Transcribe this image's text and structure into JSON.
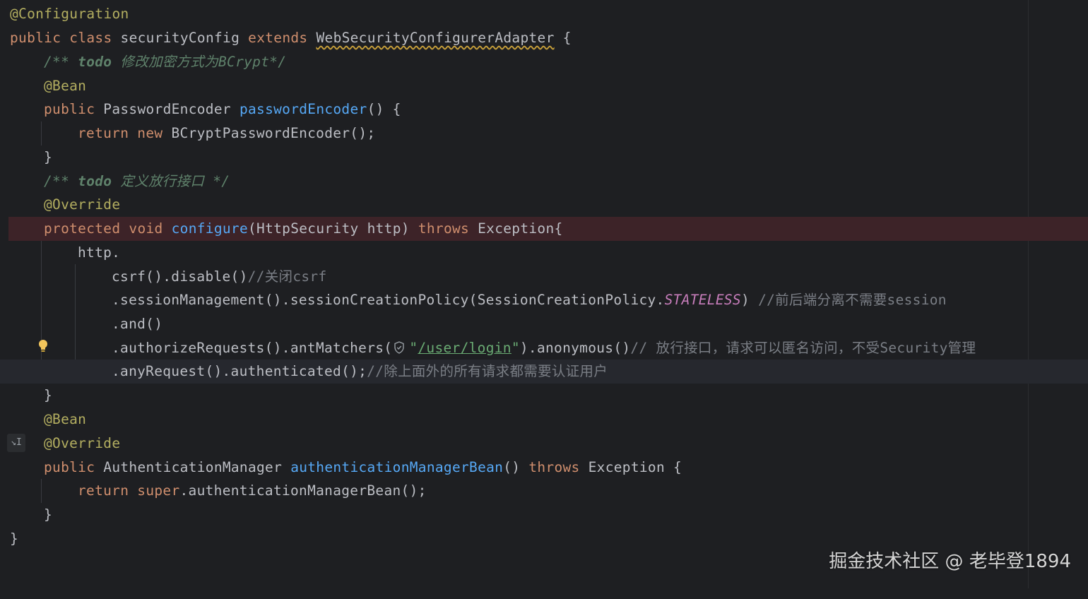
{
  "code": {
    "l1": {
      "annotation": "@Configuration"
    },
    "l2": {
      "kw_public": "public",
      "kw_class": "class",
      "class_name": "securityConfig",
      "kw_extends": "extends",
      "parent": "WebSecurityConfigurerAdapter",
      "brace": "{"
    },
    "l3": {
      "open": "/**",
      "tag": "todo",
      "text": "修改加密方式为BCrypt*/"
    },
    "l4": {
      "annotation": "@Bean"
    },
    "l5": {
      "kw_public": "public",
      "type": "PasswordEncoder",
      "method": "passwordEncoder",
      "rest": "() {"
    },
    "l6": {
      "kw_return": "return",
      "kw_new": "new",
      "rest": "BCryptPasswordEncoder();"
    },
    "l7": {
      "text": "}"
    },
    "l8": {
      "open": "/**",
      "tag": "todo",
      "text": "定义放行接口 */"
    },
    "l9": {
      "annotation": "@Override"
    },
    "l10": {
      "kw_protected": "protected",
      "kw_void": "void",
      "method": "configure",
      "params": "(HttpSecurity http)",
      "kw_throws": "throws",
      "rest": "Exception{"
    },
    "l11": {
      "text": "http."
    },
    "l12": {
      "text": "csrf().disable()",
      "comment": "//关闭csrf"
    },
    "l13": {
      "text": ".sessionManagement().sessionCreationPolicy(SessionCreationPolicy.",
      "const": "STATELESS",
      "close": ")",
      "comment": "//前后端分离不需要session"
    },
    "l14": {
      "text": ".and()"
    },
    "l15": {
      "text": ".authorizeRequests().antMatchers(",
      "quote_open": "\"",
      "str": "/user/login",
      "quote_close": "\"",
      "rest": ").anonymous()",
      "comment": "// 放行接口，请求可以匿名访问，不受Security管理"
    },
    "l16": {
      "text": ".anyRequest().authenticated();",
      "comment": "//除上面外的所有请求都需要认证用户"
    },
    "l17": {
      "text": "}"
    },
    "l18": {
      "annotation": "@Bean"
    },
    "l19": {
      "annotation": "@Override"
    },
    "l20": {
      "kw_public": "public",
      "type": "AuthenticationManager",
      "method": "authenticationManagerBean",
      "rest1": "()",
      "kw_throws": "throws",
      "rest2": "Exception {"
    },
    "l21": {
      "kw_return": "return",
      "kw_super": "super",
      "rest": ".authenticationManagerBean();"
    },
    "l22": {
      "text": "}"
    },
    "l23": {
      "text": "}"
    }
  },
  "icons": {
    "bulb": "lightbulb-icon",
    "shield": "shield-icon",
    "gutter": "override-gutter-icon"
  },
  "watermark": "掘金技术社区 @ 老毕登1894",
  "colors": {
    "background": "#1e1f22",
    "keyword": "#cf8e6d",
    "annotation": "#b3ae60",
    "method": "#56a8f5",
    "comment": "#7a7e85",
    "doc_comment": "#5f826b",
    "constant": "#c77dbb",
    "string": "#6aab73",
    "error_line": "#3d2328"
  }
}
